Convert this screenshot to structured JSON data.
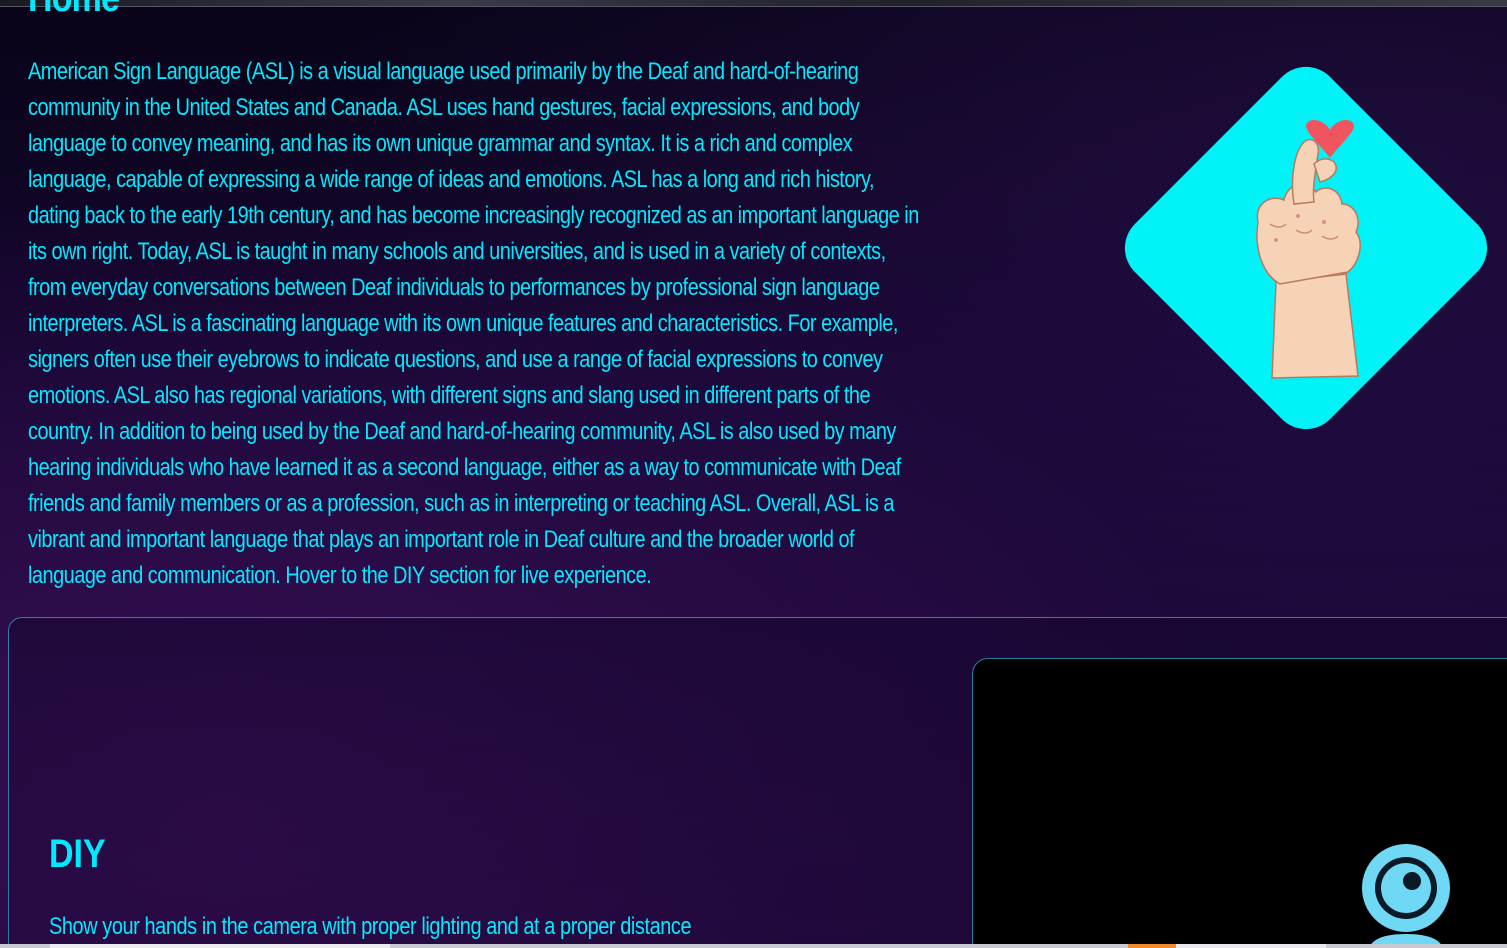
{
  "home": {
    "title": "Home",
    "description": "American Sign Language (ASL) is a visual language used primarily by the Deaf and hard-of-hearing community in the United States and Canada. ASL uses hand gestures, facial expressions, and body language to convey meaning, and has its own unique grammar and syntax. It is a rich and complex language, capable of expressing a wide range of ideas and emotions. ASL has a long and rich history, dating back to the early 19th century, and has become increasingly recognized as an important language in its own right. Today, ASL is taught in many schools and universities, and is used in a variety of contexts, from everyday conversations between Deaf individuals to performances by professional sign language interpreters. ASL is a fascinating language with its own unique features and characteristics. For example, signers often use their eyebrows to indicate questions, and use a range of facial expressions to convey emotions. ASL also has regional variations, with different signs and slang used in different parts of the country. In addition to being used by the Deaf and hard-of-hearing community, ASL is also used by many hearing individuals who have learned it as a second language, either as a way to communicate with Deaf friends and family members or as a profession, such as in interpreting or teaching ASL. Overall, ASL is a vibrant and important language that plays an important role in Deaf culture and the broader world of language and communication. Hover to the DIY section for live experience.",
    "hero_image_icon": "heart-hand-sign-icon"
  },
  "diy": {
    "title": "DIY",
    "instruction": "Show your hands in the camera with proper lighting and at a proper distance",
    "camera_icon": "camera-icon"
  },
  "colors": {
    "accent": "#00eaff",
    "diamond": "#00f3f7",
    "heart": "#f0555f",
    "background": "#150630",
    "camera_panel": "#000000"
  }
}
